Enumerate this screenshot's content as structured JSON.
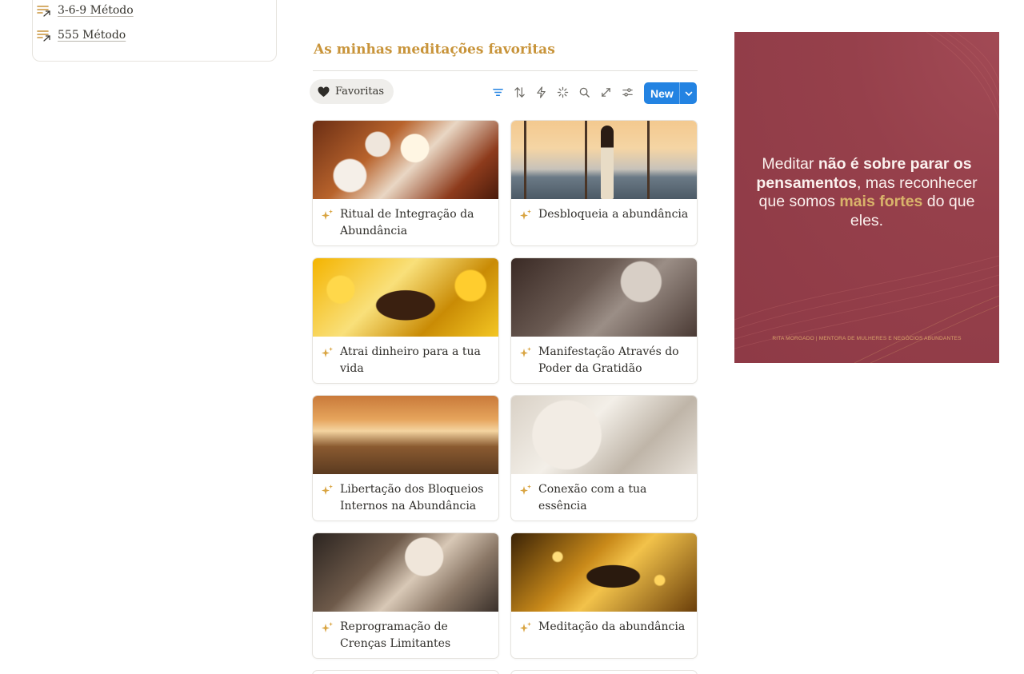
{
  "sidebar": {
    "links": [
      {
        "label": "3-6-9 Método",
        "icon": "list-arrow-icon"
      },
      {
        "label": "555 Método",
        "icon": "list-arrow-icon"
      }
    ]
  },
  "main": {
    "heading": "As minhas meditações favoritas",
    "view_tab": {
      "label": "Favoritas",
      "icon": "heart-icon"
    },
    "toolbar": {
      "icons": [
        "filter-icon",
        "sort-icon",
        "automation-icon",
        "ai-sparkle-icon",
        "search-icon",
        "expand-icon",
        "settings-icon"
      ],
      "new_label": "New"
    },
    "cards": [
      {
        "title": "Ritual de Integração da Abundância"
      },
      {
        "title": "Desbloqueia a abundância"
      },
      {
        "title": "Atrai dinheiro para a tua vida"
      },
      {
        "title": "Manifestação Através do Poder da Gratidão"
      },
      {
        "title": "Libertação dos Bloqueios Internos na Abundância"
      },
      {
        "title": "Conexão com a tua essência"
      },
      {
        "title": "Reprogramação de Crenças Limitantes"
      },
      {
        "title": "Meditação da abundância"
      }
    ]
  },
  "poster": {
    "quote": {
      "p1": "Meditar ",
      "b1": "não é sobre parar os pensamentos",
      "p2": ", mas reconhecer que somos ",
      "gold": "mais fortes",
      "p3": " do que eles."
    },
    "footer": "RITA MORGADO | MENTORA DE MULHERES E NEGÓCIOS ABUNDANTES"
  },
  "colors": {
    "accent_gold": "#c8943a",
    "button_blue": "#2383e2",
    "poster_bg": "#96404b"
  }
}
